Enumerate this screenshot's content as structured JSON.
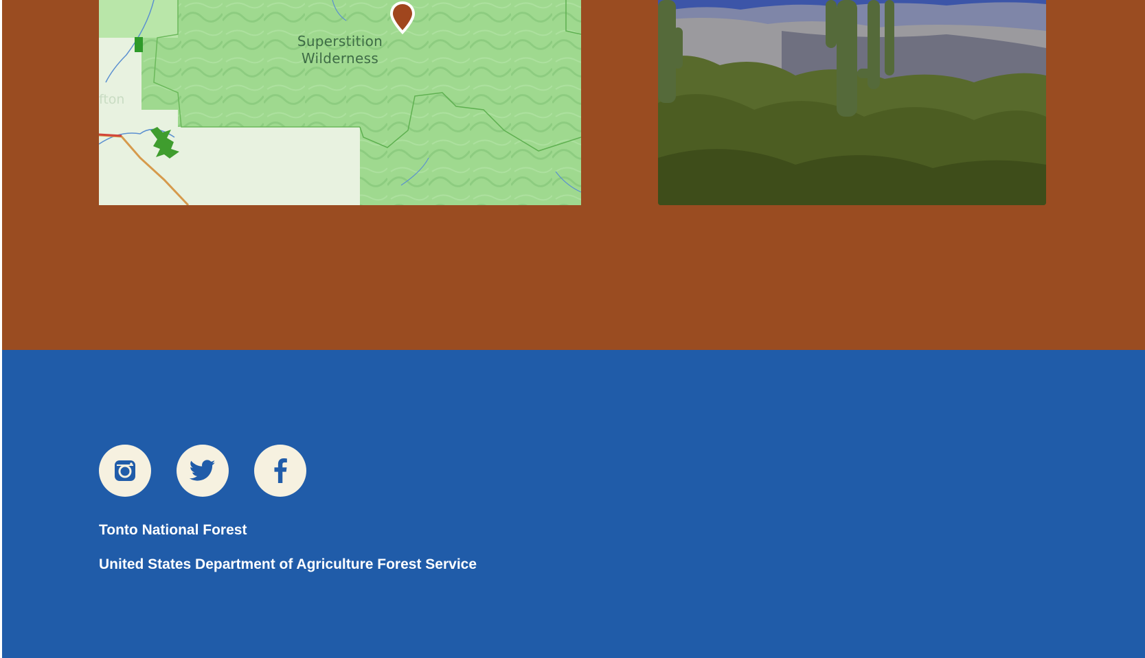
{
  "map": {
    "label_line1": "Superstition",
    "label_line2": "Wilderness",
    "faint_label": "fton",
    "pin_color": "#a0461e",
    "land_color": "#9fd98f",
    "private_color": "#e8f2e0"
  },
  "photo": {
    "alt": "Saguaro cactus among desert shrubs with mountains behind"
  },
  "footer": {
    "social": [
      {
        "name": "Instagram",
        "icon": "instagram-icon"
      },
      {
        "name": "Twitter",
        "icon": "twitter-icon"
      },
      {
        "name": "Facebook",
        "icon": "facebook-icon"
      }
    ],
    "forest_name": "Tonto National Forest",
    "agency": "United States Department of Agriculture Forest Service"
  },
  "colors": {
    "brown_section": "#9a4c21",
    "footer_blue": "#205ca9",
    "social_bg": "#f6f1e0",
    "social_icon": "#205ca9"
  }
}
